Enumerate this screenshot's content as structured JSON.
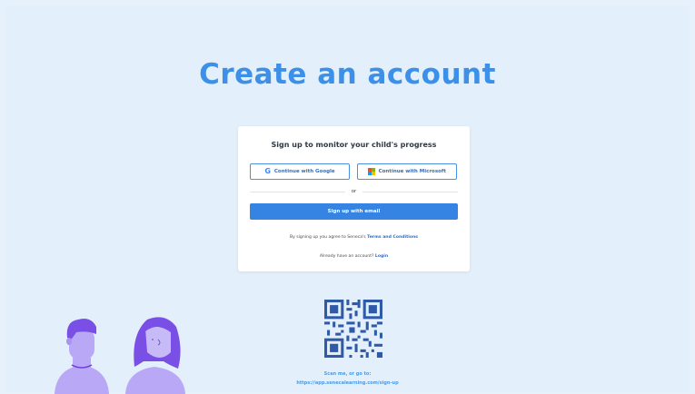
{
  "page": {
    "title": "Create an account"
  },
  "card": {
    "heading": "Sign up to monitor your child's progress",
    "google_label": "Continue with Google",
    "microsoft_label": "Continue with Microsoft",
    "divider_text": "or",
    "email_label": "Sign up with email",
    "terms_prefix": "By signing up you agree to Seneca's ",
    "terms_link": "Terms and Conditions",
    "login_prefix": "Already have an account? ",
    "login_link": "Login"
  },
  "footer": {
    "scan_text": "Scan me, or go to:",
    "url": "https://app.senecalearning.com/sign-up"
  },
  "colors": {
    "background": "#e3effb",
    "accent": "#3d90e8",
    "button_primary": "#3584e4",
    "illustration_purple": "#b4a4f2",
    "illustration_hair": "#7a4fe6"
  },
  "icons": [
    "google-icon",
    "microsoft-icon",
    "qr-code",
    "illustration-people"
  ]
}
